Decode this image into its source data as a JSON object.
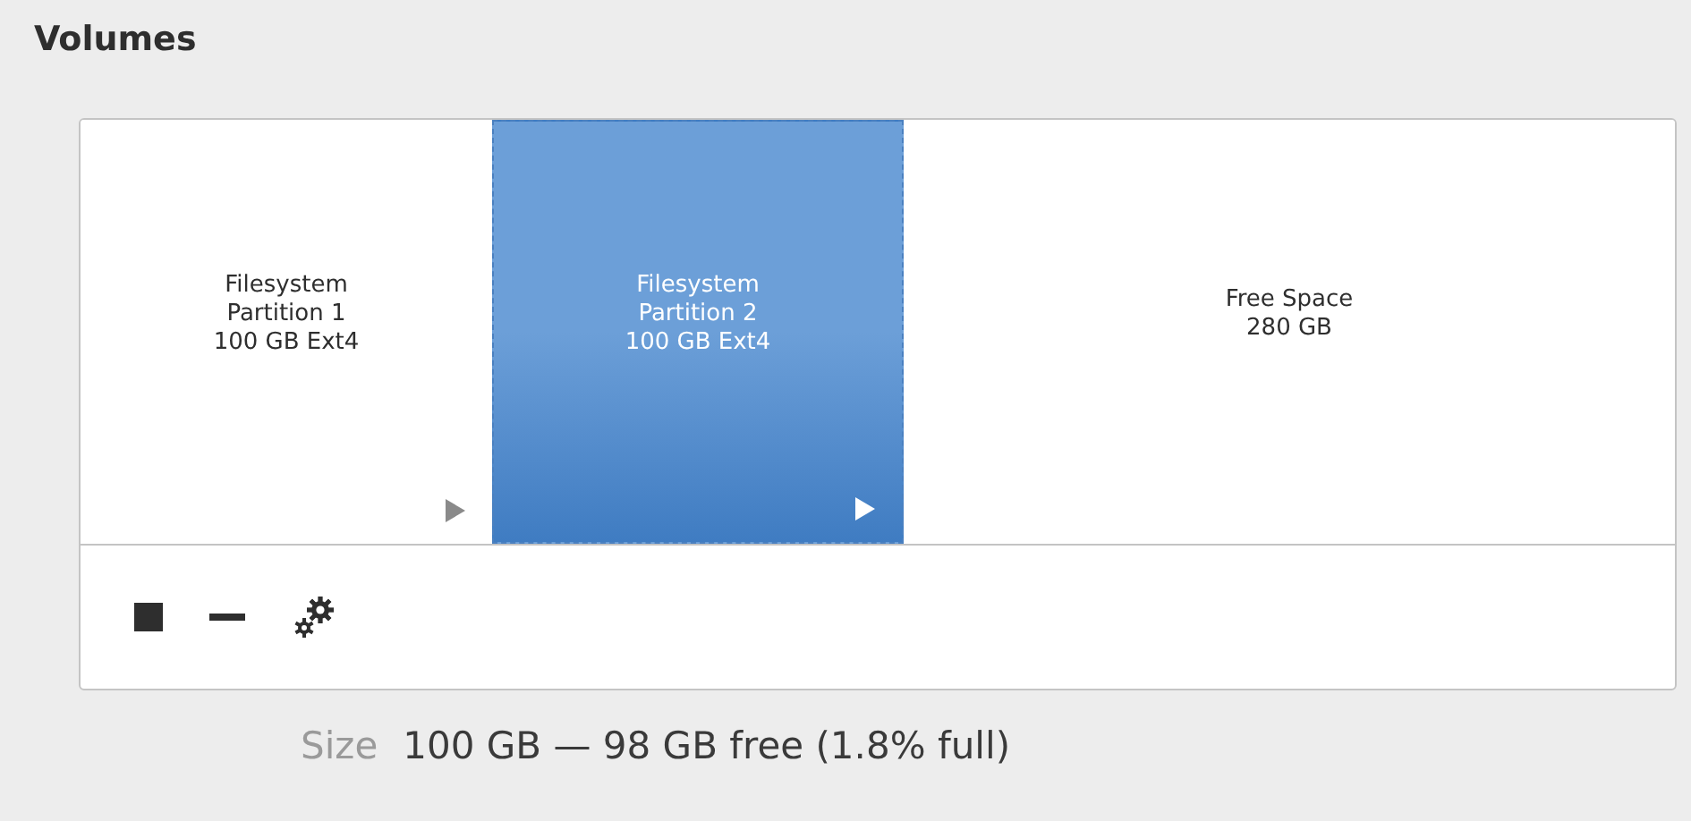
{
  "title": "Volumes",
  "volumes": [
    {
      "kind": "partition",
      "lines": [
        "Filesystem",
        "Partition 1",
        "100 GB Ext4"
      ],
      "selected": false
    },
    {
      "kind": "partition",
      "lines": [
        "Filesystem",
        "Partition 2",
        "100 GB Ext4"
      ],
      "selected": true
    },
    {
      "kind": "free",
      "lines": [
        "Free Space",
        "280 GB"
      ],
      "selected": false
    }
  ],
  "size": {
    "label": "Size",
    "value": "100 GB — 98 GB free (1.8% full)"
  }
}
